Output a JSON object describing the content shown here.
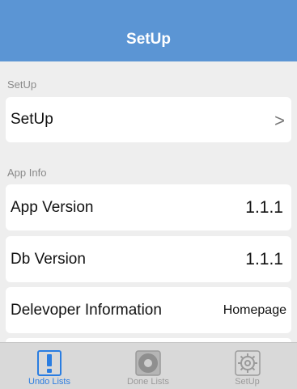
{
  "navbar": {
    "title": "SetUp"
  },
  "sections": {
    "setup": {
      "header": "SetUp",
      "cells": [
        {
          "label": "SetUp",
          "accessory": ">"
        }
      ]
    },
    "app_info": {
      "header": "App Info",
      "cells": [
        {
          "label": "App Version",
          "value": "1.1.1"
        },
        {
          "label": "Db Version",
          "value": "1.1.1"
        },
        {
          "label": "Delevoper Information",
          "value": "Homepage"
        }
      ]
    }
  },
  "tabbar": {
    "tabs": [
      {
        "label": "Undo Lists",
        "icon": "exclamation-icon",
        "active": true
      },
      {
        "label": "Done Lists",
        "icon": "disc-icon",
        "active": false
      },
      {
        "label": "SetUp",
        "icon": "gear-icon",
        "active": false
      }
    ]
  },
  "colors": {
    "accent": "#2a7de1",
    "navbar": "#5b95d4",
    "background": "#eeeeee"
  }
}
